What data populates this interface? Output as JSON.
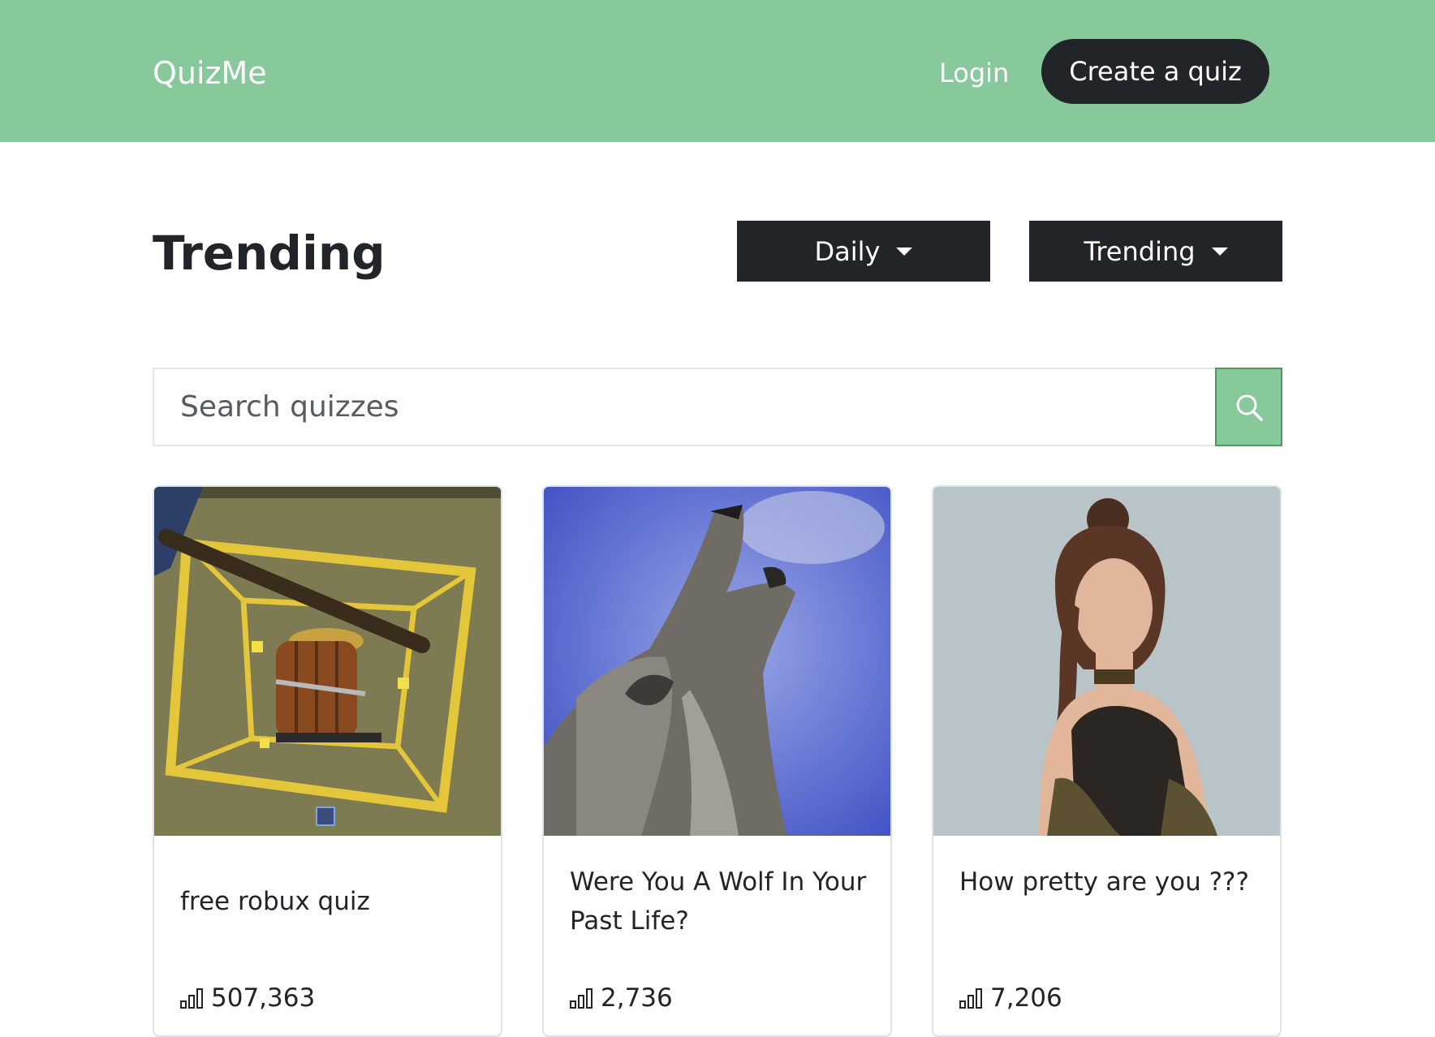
{
  "navbar": {
    "brand": "QuizMe",
    "login_label": "Login",
    "create_label": "Create a quiz"
  },
  "main": {
    "title": "Trending",
    "filters": {
      "period": {
        "selected": "Daily"
      },
      "sort": {
        "selected": "Trending"
      }
    },
    "search": {
      "placeholder": "Search quizzes",
      "value": ""
    },
    "quizzes": [
      {
        "title": "free robux quiz",
        "plays": "507,363",
        "image": "roblox-treasure-chest-image"
      },
      {
        "title": "Were You A Wolf In Your Past Life?",
        "plays": "2,736",
        "image": "howling-wolf-image"
      },
      {
        "title": "How pretty are you ???",
        "plays": "7,206",
        "image": "woman-portrait-image"
      }
    ]
  },
  "colors": {
    "navbar_bg": "#87c99a",
    "dark_button": "#212529",
    "search_button": "#87c99a"
  }
}
